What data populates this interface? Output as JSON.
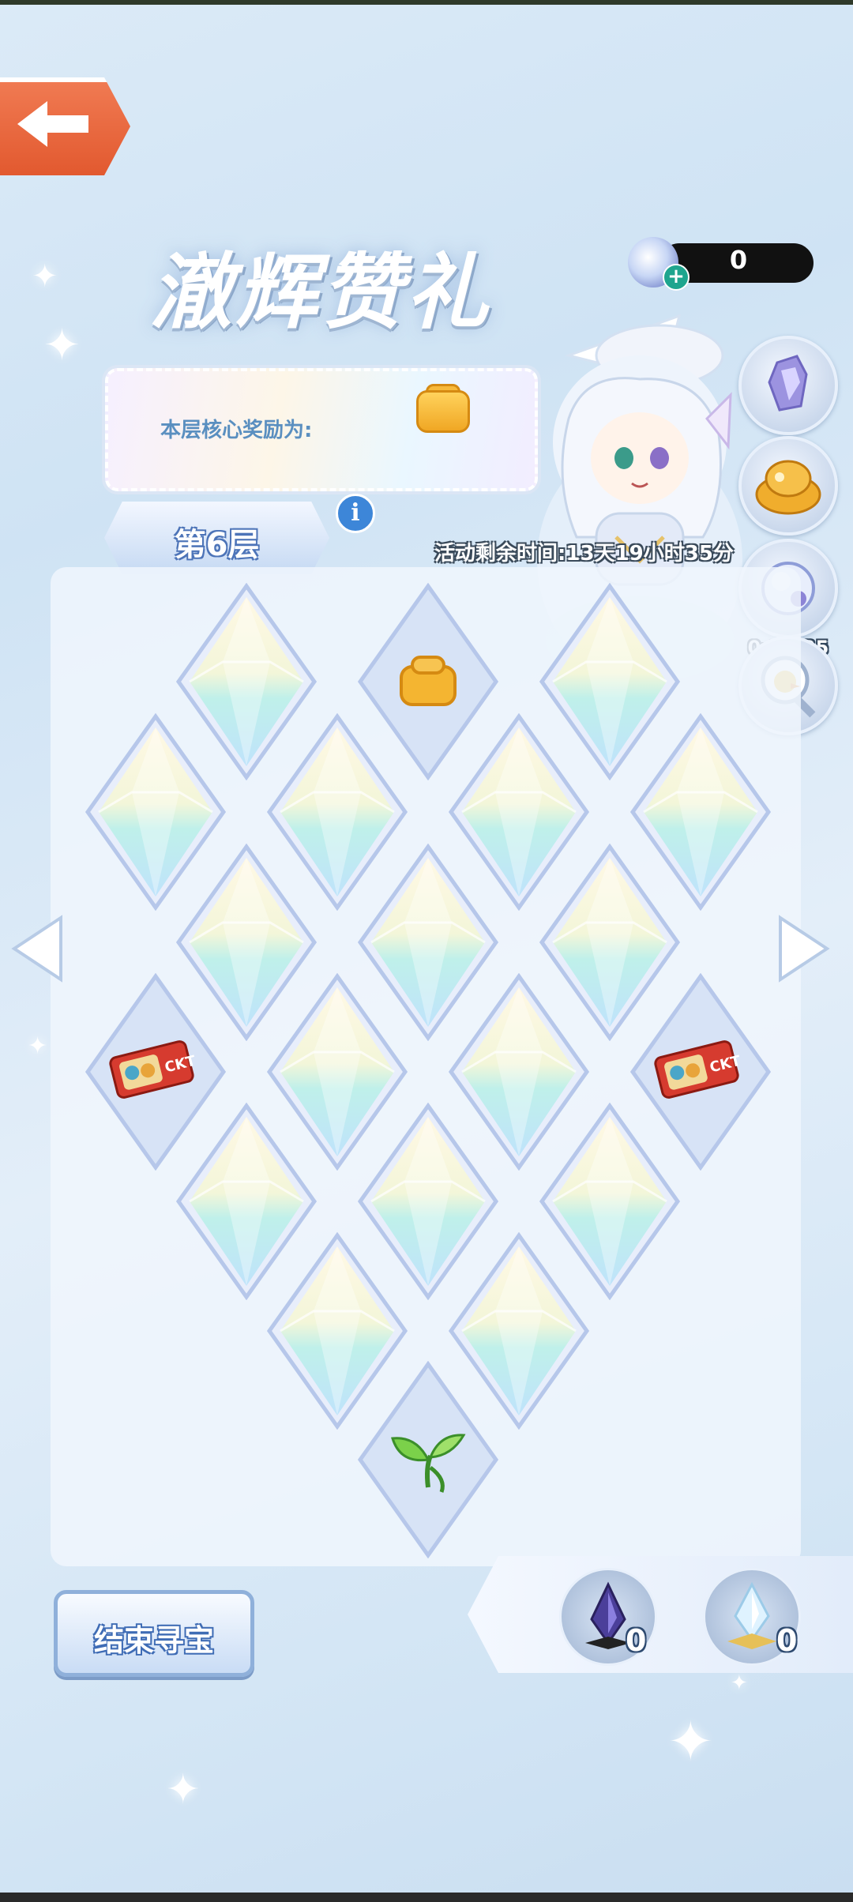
{
  "header": {
    "title": "澈辉赞礼",
    "currency_value": "0"
  },
  "core_reward": {
    "label": "本层核心奖励为:",
    "icon": "treasure-bag-icon"
  },
  "floor": {
    "label": "第6层",
    "info_icon": "i"
  },
  "event": {
    "time_remaining": "活动剩余时间:13天19小时35分"
  },
  "side_buttons": [
    {
      "name": "crystal-icon"
    },
    {
      "name": "golden-pile-icon"
    },
    {
      "name": "pearl-orb-icon",
      "timer": "0:17:25"
    },
    {
      "name": "magnifier-duck-icon"
    }
  ],
  "board": {
    "tiles": [
      {
        "state": "crystal"
      },
      {
        "state": "revealed",
        "reward": "treasure-bag-icon"
      },
      {
        "state": "crystal"
      },
      {
        "state": "crystal"
      },
      {
        "state": "crystal"
      },
      {
        "state": "crystal"
      },
      {
        "state": "crystal"
      },
      {
        "state": "crystal"
      },
      {
        "state": "crystal"
      },
      {
        "state": "crystal"
      },
      {
        "state": "revealed",
        "reward": "ticket-icon"
      },
      {
        "state": "crystal"
      },
      {
        "state": "crystal"
      },
      {
        "state": "revealed",
        "reward": "ticket-icon"
      },
      {
        "state": "crystal"
      },
      {
        "state": "crystal"
      },
      {
        "state": "crystal"
      },
      {
        "state": "crystal"
      },
      {
        "state": "crystal"
      },
      {
        "state": "revealed",
        "reward": "sprout-icon"
      }
    ]
  },
  "footer": {
    "end_button": "结束寻宝",
    "items": [
      {
        "name": "dark-crystal-icon",
        "count": "0"
      },
      {
        "name": "light-crystal-icon",
        "count": "0"
      }
    ]
  }
}
